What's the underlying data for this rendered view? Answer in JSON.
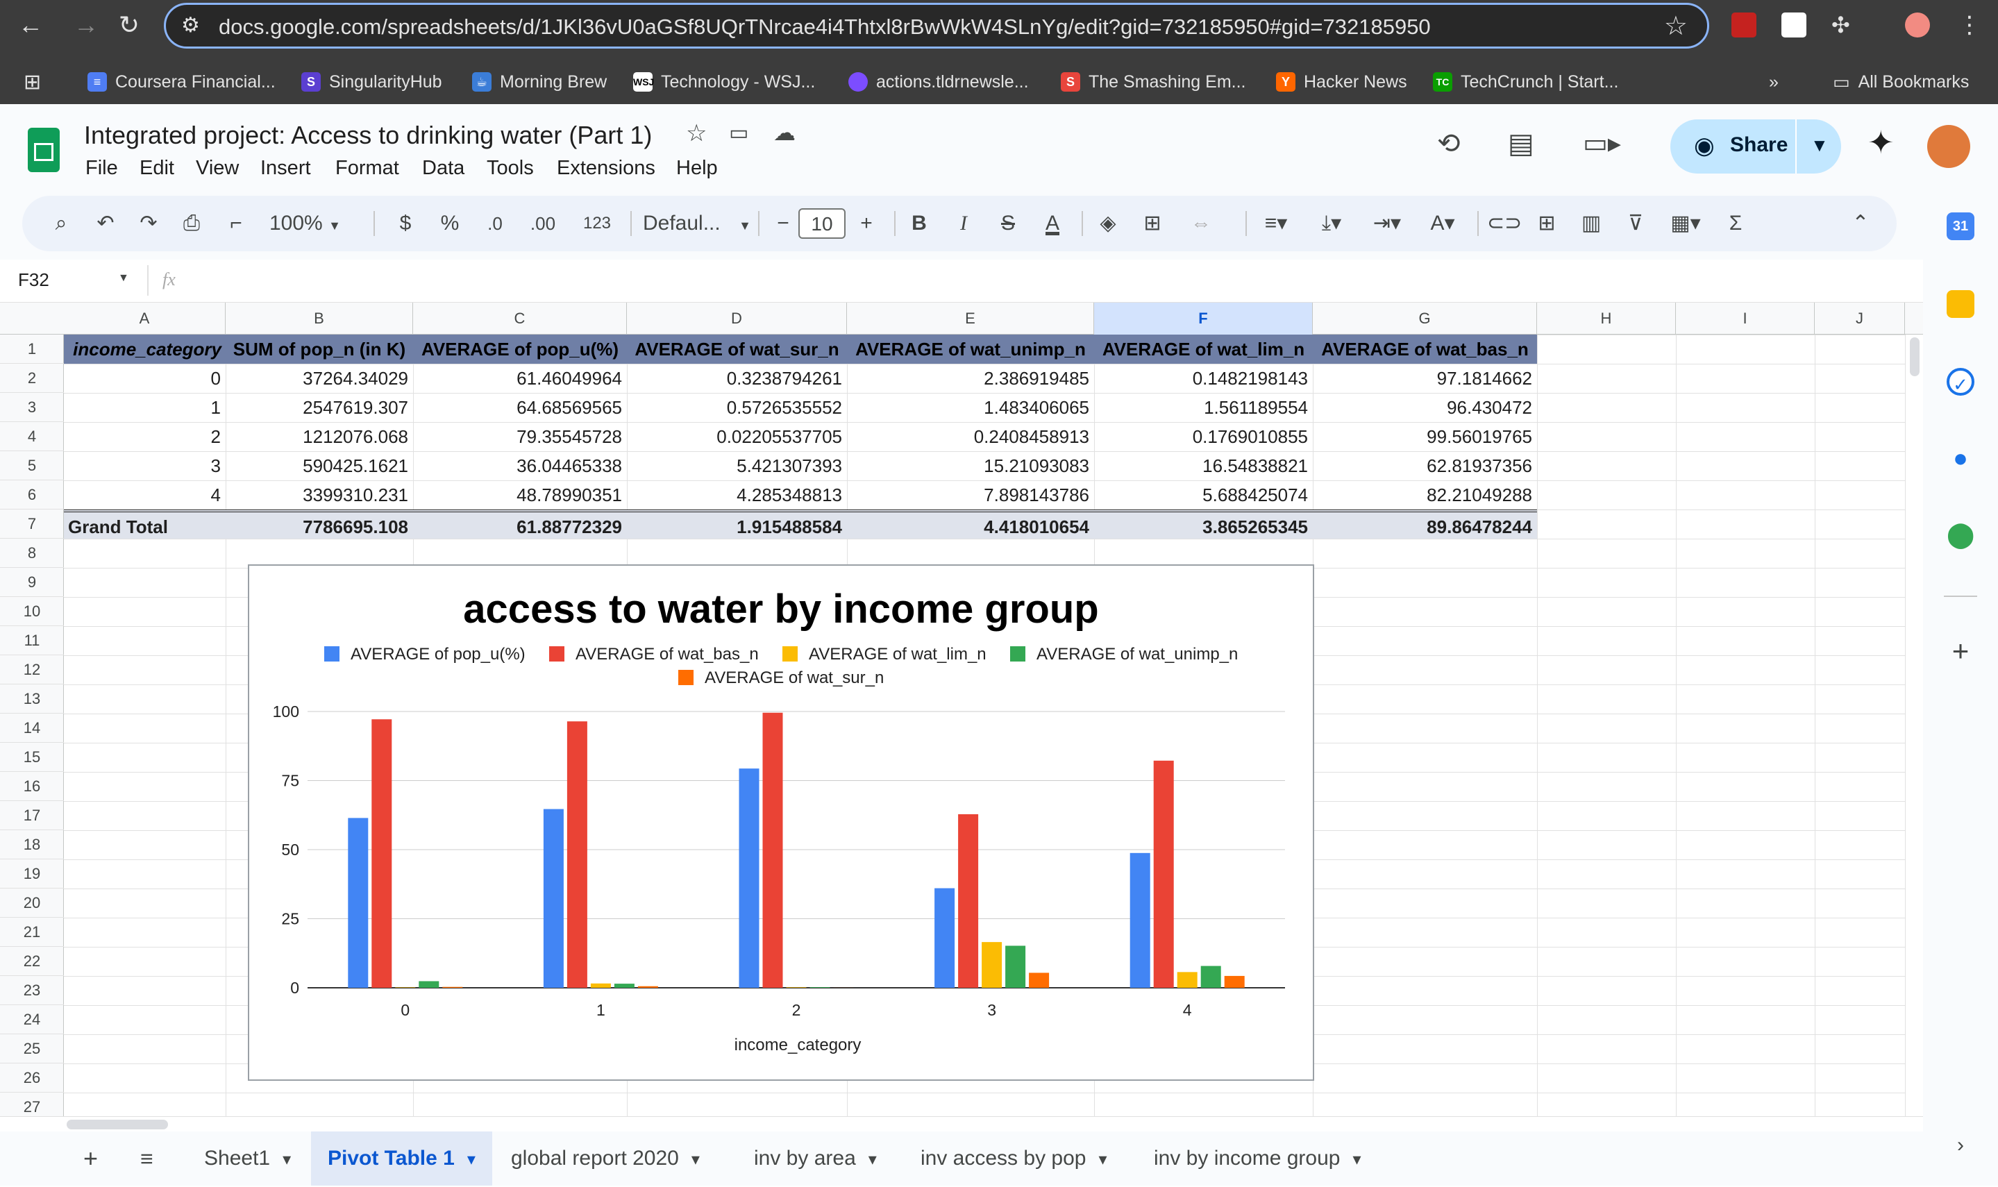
{
  "browser": {
    "url": "docs.google.com/spreadsheets/d/1JKl36vU0aGSf8UQrTNrcae4i4Thtxl8rBwWkW4SLnYg/edit?gid=732185950#gid=732185950",
    "bookmarks": [
      {
        "label": "Coursera Financial...",
        "icon": "coursera-icon",
        "color": "#4f7df3"
      },
      {
        "label": "SingularityHub",
        "icon": "singularity-icon",
        "color": "#5b3fd1"
      },
      {
        "label": "Morning Brew",
        "icon": "morning-brew-icon",
        "color": "#3b7dd8"
      },
      {
        "label": "Technology - WSJ...",
        "icon": "wsj-icon",
        "color": "#ffffff"
      },
      {
        "label": "actions.tldrnewsle...",
        "icon": "tldr-icon",
        "color": "#7c4dff"
      },
      {
        "label": "The Smashing Em...",
        "icon": "smashing-icon",
        "color": "#e8453c"
      },
      {
        "label": "Hacker News",
        "icon": "hacker-news-icon",
        "color": "#ff6600"
      },
      {
        "label": "TechCrunch | Start...",
        "icon": "techcrunch-icon",
        "color": "#0a9e01"
      }
    ],
    "all_bookmarks": "All Bookmarks",
    "overflow": "»"
  },
  "sheet": {
    "title": "Integrated project: Access to drinking water (Part 1)",
    "menu": [
      "File",
      "Edit",
      "View",
      "Insert",
      "Format",
      "Data",
      "Tools",
      "Extensions",
      "Help"
    ],
    "share_label": "Share",
    "toolbar": {
      "zoom": "100%",
      "currency": "$",
      "percent": "%",
      "dec_decrease": ".0",
      "dec_increase": ".00",
      "number_format": "123",
      "font": "Defaul...",
      "font_size": "10",
      "bold": "B",
      "italic": "I",
      "strike": "S",
      "text_color": "A",
      "sigma": "Σ"
    },
    "name_box": "F32",
    "fx": "fx"
  },
  "grid": {
    "columns": [
      "A",
      "B",
      "C",
      "D",
      "E",
      "F",
      "G",
      "H",
      "I",
      "J"
    ],
    "selected_column": "F",
    "rows": [
      "1",
      "2",
      "3",
      "4",
      "5",
      "6",
      "7",
      "8",
      "9",
      "10",
      "11",
      "12",
      "13",
      "14",
      "15",
      "16",
      "17",
      "18",
      "19",
      "20",
      "21",
      "22",
      "23",
      "24",
      "25",
      "26",
      "27"
    ],
    "pivot_headers": [
      "income_category",
      "SUM of pop_n (in K)",
      "AVERAGE of pop_u(%)",
      "AVERAGE of wat_sur_n",
      "AVERAGE of wat_unimp_n",
      "AVERAGE of wat_lim_n",
      "AVERAGE of wat_bas_n"
    ],
    "pivot_rows": [
      [
        "0",
        "37264.34029",
        "61.46049964",
        "0.3238794261",
        "2.386919485",
        "0.1482198143",
        "97.1814662"
      ],
      [
        "1",
        "2547619.307",
        "64.68569565",
        "0.5726535552",
        "1.483406065",
        "1.561189554",
        "96.430472"
      ],
      [
        "2",
        "1212076.068",
        "79.35545728",
        "0.02205537705",
        "0.2408458913",
        "0.1769010855",
        "99.56019765"
      ],
      [
        "3",
        "590425.1621",
        "36.04465338",
        "5.421307393",
        "15.21093083",
        "16.54838821",
        "62.81937356"
      ],
      [
        "4",
        "3399310.231",
        "48.78990351",
        "4.285348813",
        "7.898143786",
        "5.688425074",
        "82.21049288"
      ]
    ],
    "grand_total": [
      "Grand Total",
      "7786695.108",
      "61.88772329",
      "1.915488584",
      "4.418010654",
      "3.865265345",
      "89.86478244"
    ]
  },
  "chart_data": {
    "type": "bar",
    "title": "access to water by income group",
    "xlabel": "income_category",
    "ylabel": "",
    "categories": [
      "0",
      "1",
      "2",
      "3",
      "4"
    ],
    "ylim": [
      0,
      100
    ],
    "yticks": [
      0,
      25,
      50,
      75,
      100
    ],
    "grid": true,
    "legend_position": "top",
    "series": [
      {
        "name": "AVERAGE of pop_u(%)",
        "color": "#4285f4",
        "values": [
          61.46,
          64.69,
          79.36,
          36.04,
          48.79
        ]
      },
      {
        "name": "AVERAGE of wat_bas_n",
        "color": "#ea4335",
        "values": [
          97.18,
          96.43,
          99.56,
          62.82,
          82.21
        ]
      },
      {
        "name": "AVERAGE of wat_lim_n",
        "color": "#fbbc04",
        "values": [
          0.15,
          1.56,
          0.18,
          16.55,
          5.69
        ]
      },
      {
        "name": "AVERAGE of wat_unimp_n",
        "color": "#34a853",
        "values": [
          2.39,
          1.48,
          0.24,
          15.21,
          7.9
        ]
      },
      {
        "name": "AVERAGE of wat_sur_n",
        "color": "#ff6d01",
        "values": [
          0.32,
          0.57,
          0.02,
          5.42,
          4.29
        ]
      }
    ]
  },
  "tabs": {
    "items": [
      "Sheet1",
      "Pivot Table 1",
      "global report 2020",
      "inv by area",
      "inv access by pop",
      "inv by income group"
    ],
    "active": "Pivot Table 1"
  }
}
